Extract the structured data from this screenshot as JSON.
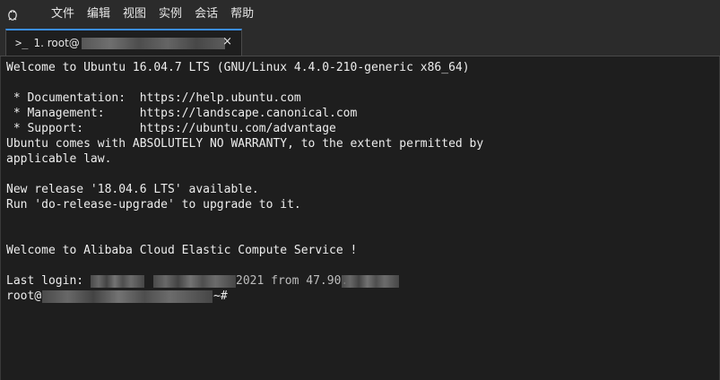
{
  "menubar": {
    "app_icon": "tux-icon",
    "items": [
      "文件",
      "编辑",
      "视图",
      "实例",
      "会话",
      "帮助"
    ]
  },
  "tab": {
    "prompt": ">_",
    "title": "1. root@",
    "close": "×"
  },
  "terminal": {
    "lines": [
      "Welcome to Ubuntu 16.04.7 LTS (GNU/Linux 4.4.0-210-generic x86_64)",
      "",
      " * Documentation:  https://help.ubuntu.com",
      " * Management:     https://landscape.canonical.com",
      " * Support:        https://ubuntu.com/advantage",
      "Ubuntu comes with ABSOLUTELY NO WARRANTY, to the extent permitted by",
      "applicable law.",
      "",
      "New release '18.04.6 LTS' available.",
      "Run 'do-release-upgrade' to upgrade to it.",
      "",
      "",
      "Welcome to Alibaba Cloud Elastic Compute Service !",
      "",
      "Last login:",
      "root@"
    ],
    "last_login_partial": "2021 from 47.90.",
    "prompt_suffix": "~#"
  },
  "colors": {
    "background": "#1e1e1e",
    "menubar": "#2b2b2b",
    "accent": "#3b8eea",
    "text": "#ededed"
  }
}
